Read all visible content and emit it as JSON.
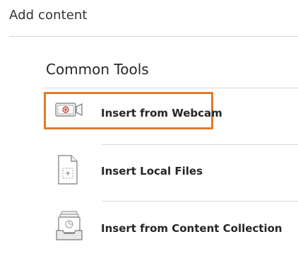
{
  "panel": {
    "title": "Add content"
  },
  "section": {
    "title": "Common Tools"
  },
  "tools": [
    {
      "label": "Insert from Webcam",
      "icon": "webcam-icon",
      "focused": true
    },
    {
      "label": "Insert Local Files",
      "icon": "file-icon",
      "focused": false
    },
    {
      "label": "Insert from Content Collection",
      "icon": "content-collection-icon",
      "focused": false
    }
  ],
  "colors": {
    "focus_ring": "#e07b2a",
    "text": "#262626",
    "divider": "#d8d8d8",
    "icon_accent": "#c0392b"
  }
}
